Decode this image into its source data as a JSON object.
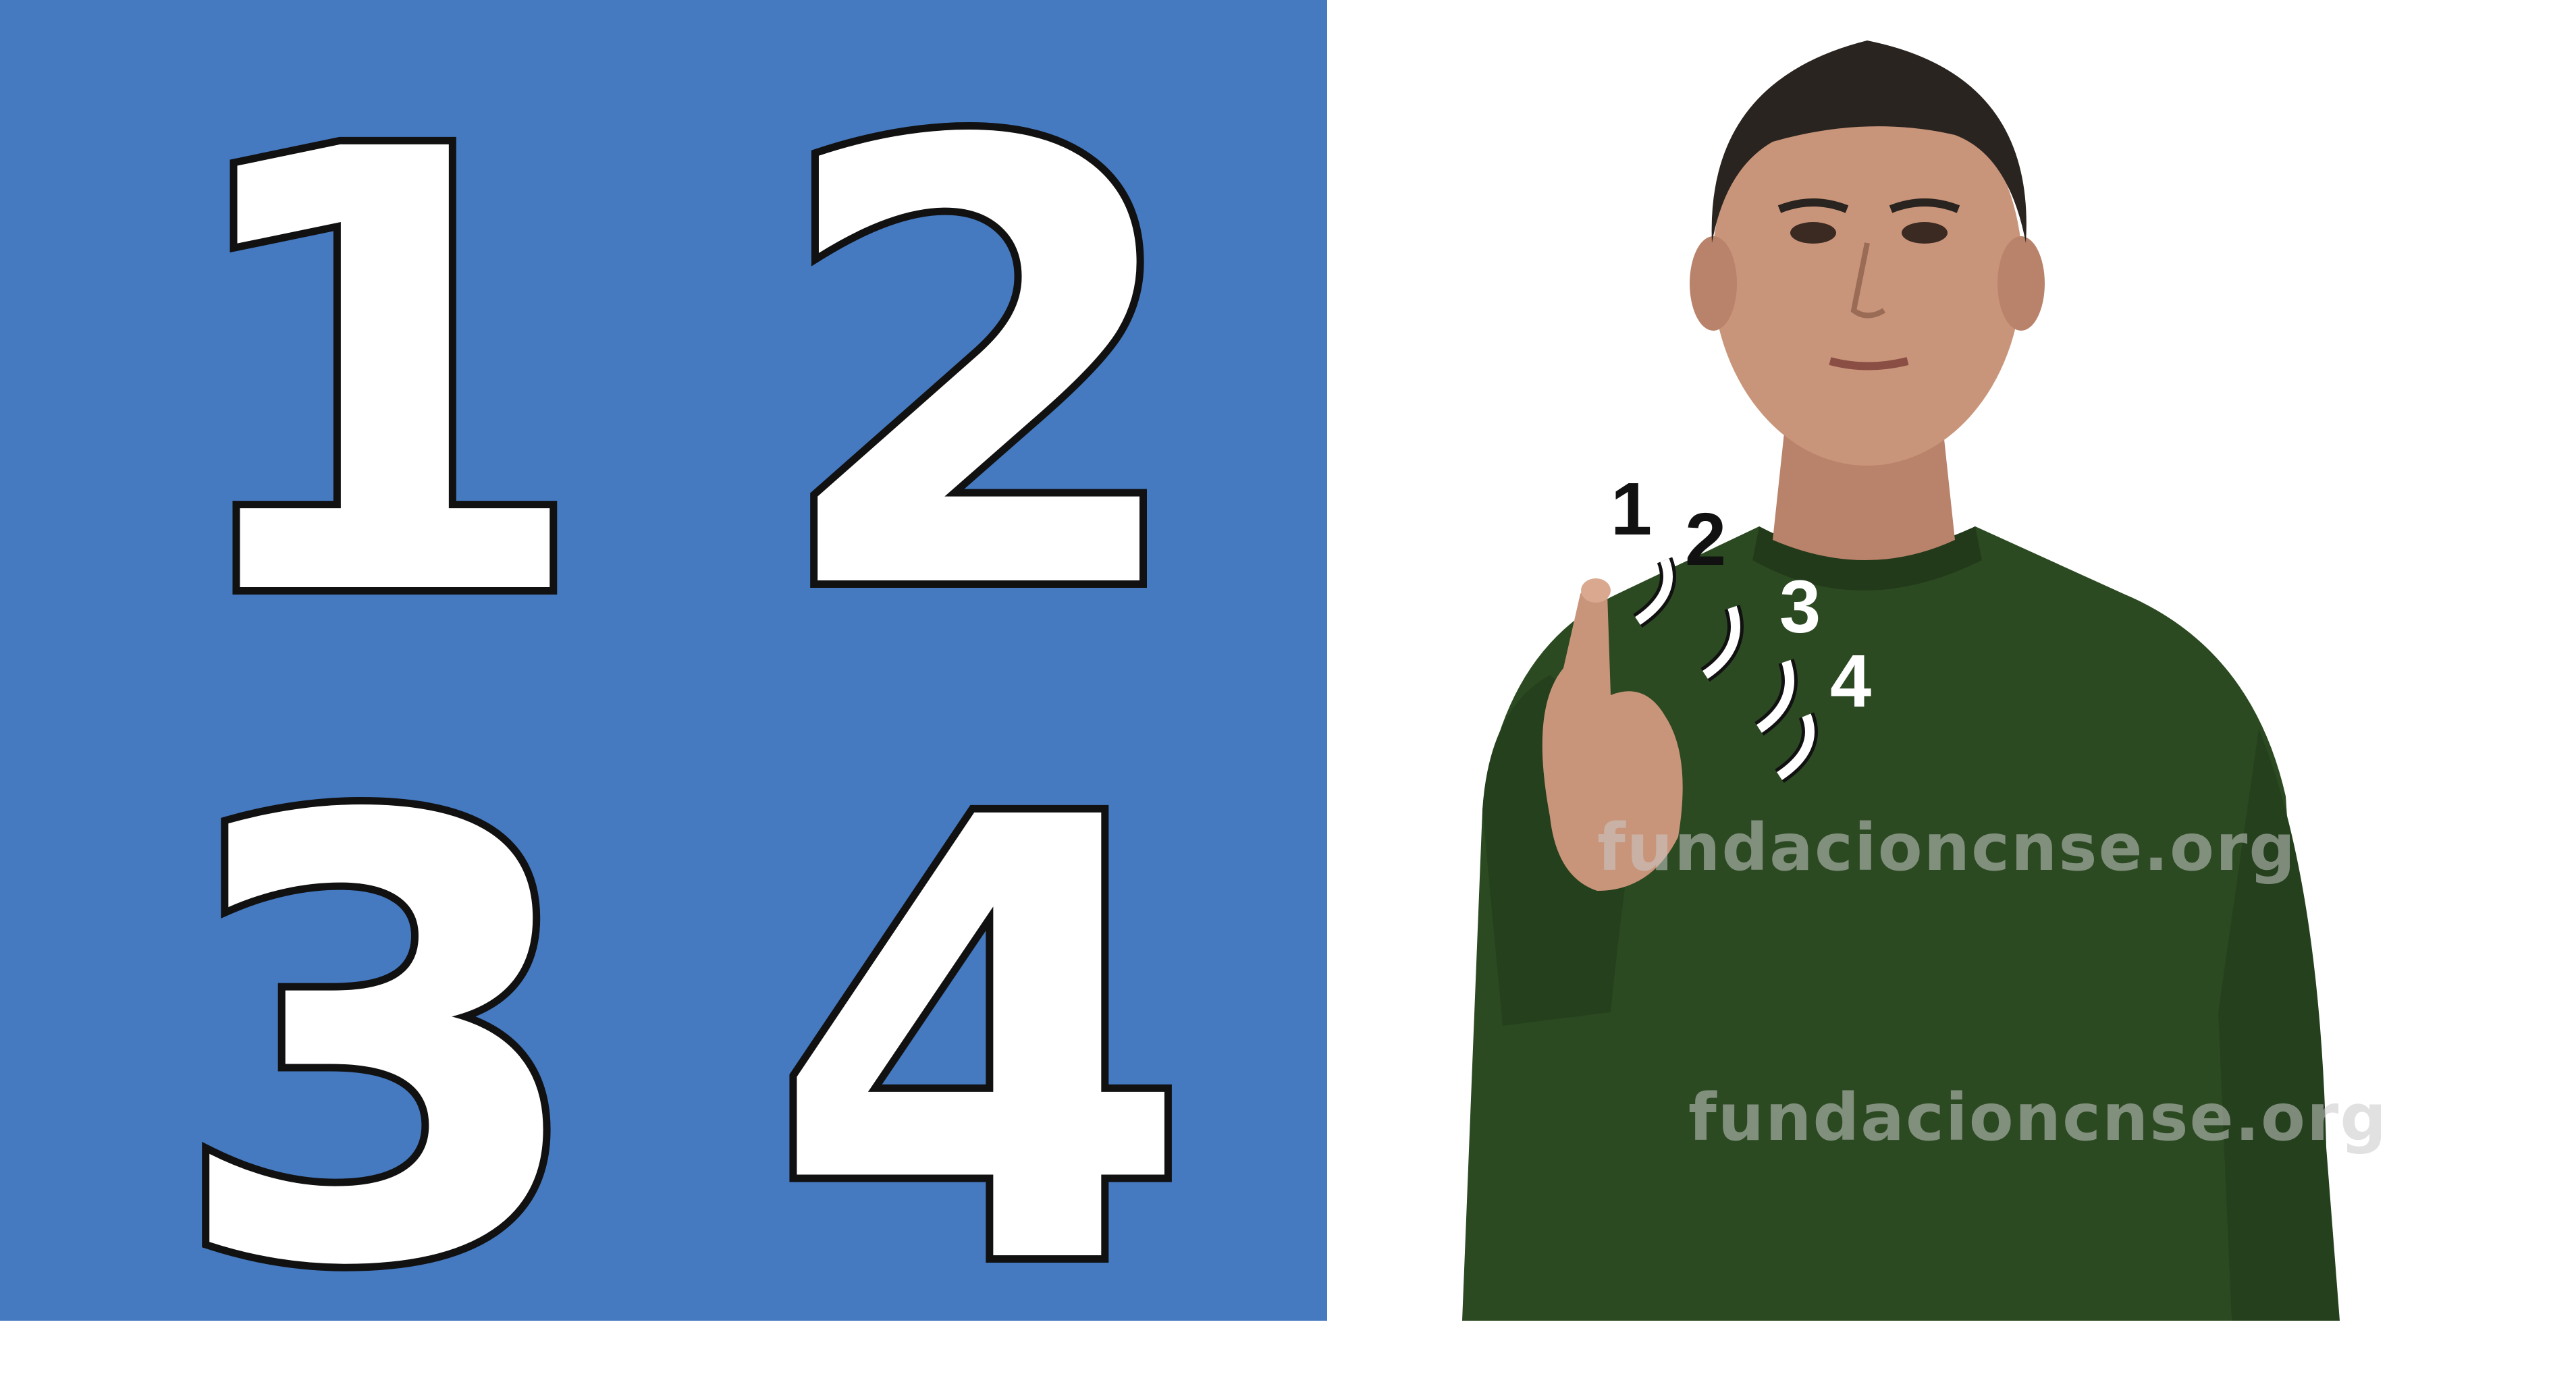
{
  "numbers_panel": {
    "digits": [
      "1",
      "2",
      "3",
      "4"
    ],
    "background": "#4579c0"
  },
  "sign_figure": {
    "movement_steps": [
      "1",
      "2",
      "3",
      "4"
    ],
    "watermarks": [
      "fundacioncnse.org",
      "fundacioncnse.org"
    ]
  },
  "colors": {
    "shirt": "#2c4a22",
    "skin": "#c9957a",
    "hair": "#2a2420"
  }
}
